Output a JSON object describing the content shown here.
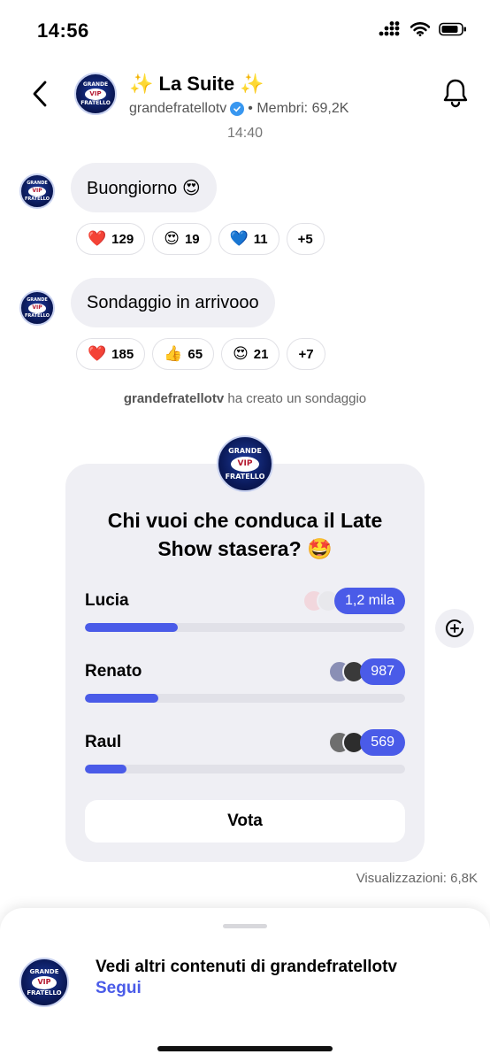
{
  "status": {
    "time": "14:56"
  },
  "logo": {
    "top": "GRANDE",
    "middle": "VIP",
    "bottom": "FRATELLO"
  },
  "header": {
    "title": "✨ La Suite ✨",
    "username": "grandefratellotv",
    "members": "• Membri: 69,2K"
  },
  "time_separator": "14:40",
  "messages": [
    {
      "text": "Buongiorno 😍",
      "reactions": [
        {
          "emoji": "❤️",
          "count": "129"
        },
        {
          "emoji": "😍",
          "count": "19"
        },
        {
          "emoji": "💙",
          "count": "11"
        },
        {
          "emoji": "",
          "count": "+5"
        }
      ]
    },
    {
      "text": "Sondaggio in arrivooo",
      "reactions": [
        {
          "emoji": "❤️",
          "count": "185"
        },
        {
          "emoji": "👍",
          "count": "65"
        },
        {
          "emoji": "😍",
          "count": "21"
        },
        {
          "emoji": "",
          "count": "+7"
        }
      ]
    }
  ],
  "system": {
    "user": "grandefratellotv",
    "text": "ha creato un sondaggio"
  },
  "poll": {
    "question": "Chi vuoi che conduca il Late Show stasera? 🤩",
    "options": [
      {
        "label": "Lucia",
        "count": "1,2 mila",
        "fraction": 0.29
      },
      {
        "label": "Renato",
        "count": "987",
        "fraction": 0.23
      },
      {
        "label": "Raul",
        "count": "569",
        "fraction": 0.13
      }
    ],
    "vote_label": "Vota"
  },
  "views": "Visualizzazioni: 6,8K",
  "sheet": {
    "title": "Vedi altri contenuti di grandefratellotv",
    "link": "Segui"
  },
  "colors": {
    "accent": "#4a5be8",
    "bubble": "#efeff4"
  }
}
